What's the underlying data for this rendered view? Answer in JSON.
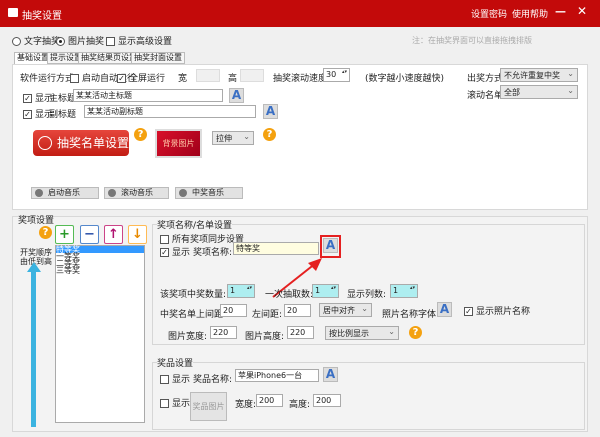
{
  "title": "抽奖设置",
  "titlebar": {
    "set_password": "设置密码",
    "help": "使用帮助",
    "minimize": "—",
    "close": "✕"
  },
  "mode": {
    "text_lottery": "文字抽奖",
    "image_lottery": "图片抽奖",
    "show_advanced": "显示高级设置",
    "note": "注：在抽奖界面可以直接拖拽排版"
  },
  "tabs": [
    "基础设置",
    "提示设置",
    "抽奖结果页设置",
    "抽奖封面设置"
  ],
  "basic": {
    "run_mode_label": "软件运行方式",
    "autostart": "启动自动运行",
    "fullscreen": "全屏运行",
    "width_label": "宽",
    "height_label": "高",
    "speed_label": "抽奖滚动速度",
    "speed_value": "30",
    "speed_hint": "(数字越小速度越快)",
    "draw_mode_label": "出奖方式",
    "draw_mode_value": "不允许重复中奖",
    "scroll_list_label": "滚动名单",
    "scroll_list_value": "全部",
    "show": "显示",
    "main_title_label": "主标题",
    "main_title_value": "某某活动主标题",
    "sub_title_label": "副标题",
    "sub_title_value": "某某活动副标题",
    "list_settings_button": "抽奖名单设置",
    "bg_image_button": "背景图片",
    "stretch_value": "拉伸",
    "music": [
      "启动音乐",
      "滚动音乐",
      "中奖音乐"
    ]
  },
  "prize": {
    "section_label": "奖项设置",
    "order_label_1": "开奖顺序",
    "order_label_2": "由低到高",
    "items": [
      "特等奖",
      "一等奖",
      "二等奖",
      "三等奖"
    ],
    "name_group": "奖项名称/名单设置",
    "sync_all": "所有奖项同步设置",
    "show": "显示",
    "prize_name_label": "奖项名称:",
    "prize_name_value": "特等奖",
    "win_count_label": "该奖项中奖数量:",
    "win_count_value": "1",
    "per_draw_label": "一次抽取数:",
    "per_draw_value": "1",
    "columns_label": "显示列数:",
    "columns_value": "1",
    "top_margin_label": "中奖名单上间距:",
    "top_margin_value": "20",
    "left_margin_label": "左间距:",
    "left_margin_value": "20",
    "align_value": "居中对齐",
    "photo_font_label": "照片名称字体",
    "show_photo_name": "显示照片名称",
    "img_width_label": "图片宽度:",
    "img_width_value": "220",
    "img_height_label": "图片高度:",
    "img_height_value": "220",
    "scale_value": "按比例显示"
  },
  "goods": {
    "group": "奖品设置",
    "show": "显示",
    "name_label": "奖品名称:",
    "name_value": "苹果iPhone6一台",
    "image_button": "奖品图片",
    "width_label": "宽度:",
    "width_value": "200",
    "height_label": "高度:",
    "height_value": "200"
  },
  "font_icon": "A",
  "help_icon": "?",
  "colors": {
    "title_bar": "#c30a0a",
    "highlight": "#e52020",
    "selection": "#3399ff"
  }
}
